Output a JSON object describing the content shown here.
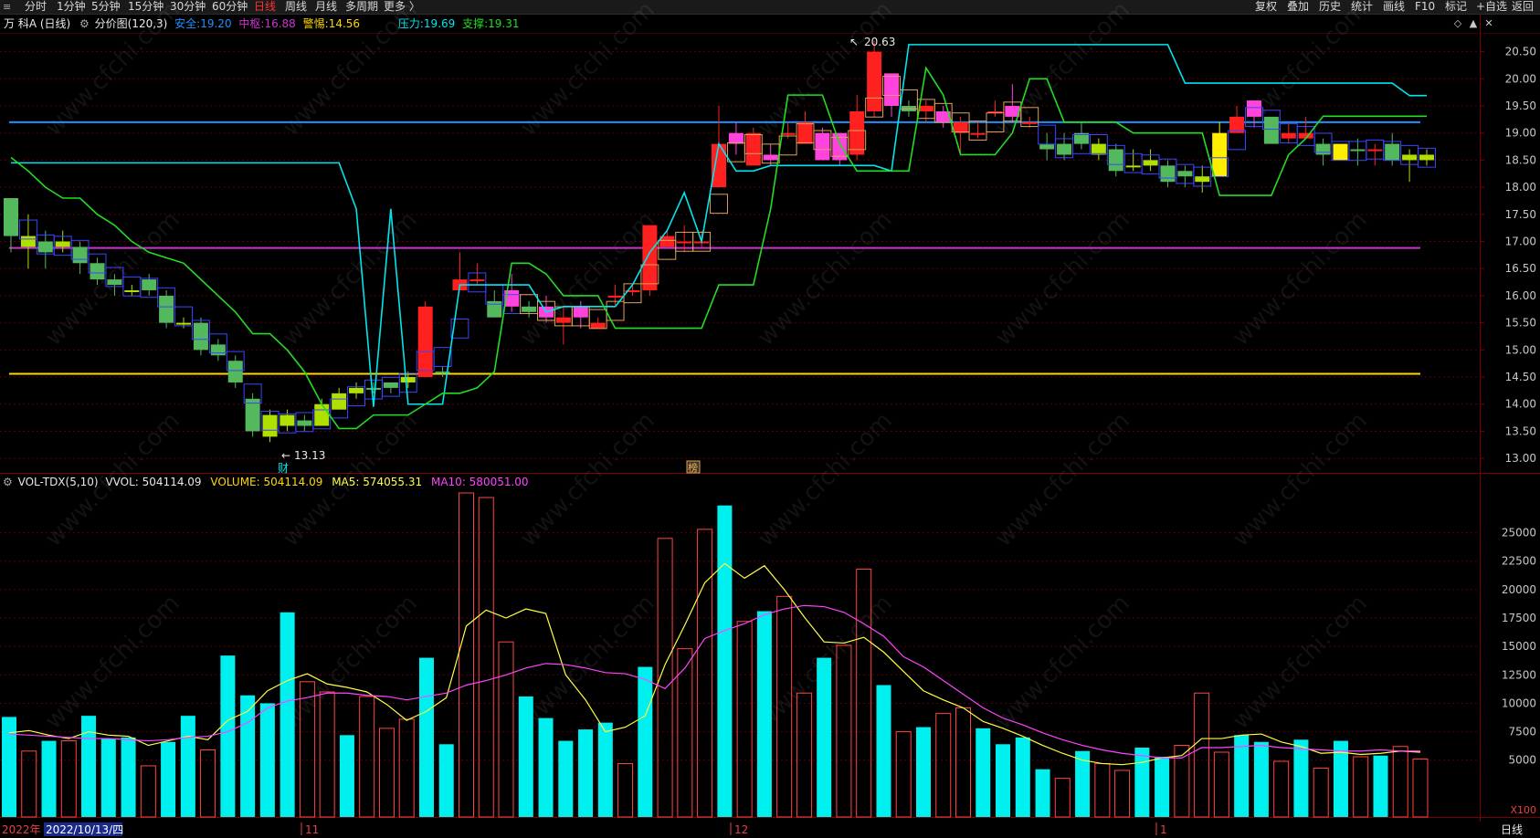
{
  "toolbar": {
    "periods": [
      "分时",
      "1分钟",
      "5分钟",
      "15分钟",
      "30分钟",
      "60分钟",
      "日线",
      "周线",
      "月线",
      "多周期",
      "更多 〉"
    ],
    "active_period": "日线",
    "right_buttons": [
      "复权",
      "叠加",
      "历史",
      "统计",
      "画线",
      "F10",
      "标记",
      "+自选",
      "返回"
    ]
  },
  "info": {
    "stock": "万 科A (日线)",
    "indicator": "分价图(120,3)",
    "safe_label": "安全:",
    "safe_value": "19.20",
    "mid_label": "中枢:",
    "mid_value": "16.88",
    "warn_label": "警惕:",
    "warn_value": "14.56",
    "pressure_label": "压力:",
    "pressure_value": "19.69",
    "support_label": "支撑:",
    "support_value": "19.31",
    "high_marker": "20.63",
    "low_marker": "13.13",
    "cai_marker": "财",
    "bang_marker": "榜"
  },
  "volume_info": {
    "name": "VOL-TDX(5,10)",
    "vvol": "VVOL: 504114.09",
    "volume": "VOLUME: 504114.09",
    "ma5": "MA5: 574055.31",
    "ma10": "MA10: 580051.00",
    "unit": "X100"
  },
  "dates": {
    "year_prefix": "2022年",
    "cursor_date": "2022/10/13/四",
    "nov": "11",
    "dec": "12",
    "jan": "1",
    "period_tab": "日线"
  },
  "watermark": "www.cfchi.com",
  "colors": {
    "up": "#ff2020",
    "up_pink": "#ff44dd",
    "down": "#54b85c",
    "down_lime": "#b0e000",
    "down_yellow": "#ffee00",
    "safe": "#1e90ff",
    "mid": "#cc33cc",
    "warn": "#ffd700",
    "pressure": "#00e5ee",
    "support": "#22dd22",
    "vol_up": "#ff4444",
    "vol_down": "#00f0f0"
  },
  "chart_data": {
    "type": "candlestick",
    "price_axis": {
      "ticks": [
        13.0,
        13.5,
        14.0,
        14.5,
        15.0,
        15.5,
        16.0,
        16.5,
        17.0,
        17.5,
        18.0,
        18.5,
        19.0,
        19.5,
        20.0,
        20.5
      ],
      "labels": [
        "13.00",
        "13.50",
        "14.00",
        "14.50",
        "15.00",
        "15.50",
        "16.00",
        "16.50",
        "17.00",
        "17.50",
        "18.00",
        "18.50",
        "19.00",
        "19.50",
        "20.00",
        "20.50"
      ],
      "range": [
        12.75,
        20.83
      ]
    },
    "volume_axis": {
      "ticks": [
        5000,
        7500,
        10000,
        12500,
        15000,
        17500,
        20000,
        22500,
        25000
      ],
      "labels": [
        "5000",
        "7500",
        "10000",
        "12500",
        "15000",
        "17500",
        "20000",
        "22500",
        "25000"
      ],
      "range": [
        0,
        28500
      ]
    },
    "levels": {
      "safe": 19.2,
      "mid": 16.88,
      "warn": 14.56
    },
    "candles": [
      [
        17.8,
        17.1,
        17.8,
        16.8,
        "d"
      ],
      [
        17.1,
        16.9,
        17.5,
        16.5,
        "l"
      ],
      [
        17.0,
        16.8,
        17.2,
        16.5,
        "d"
      ],
      [
        16.9,
        17.0,
        17.2,
        16.8,
        "l"
      ],
      [
        16.9,
        16.6,
        17.0,
        16.4,
        "d"
      ],
      [
        16.6,
        16.3,
        16.7,
        16.2,
        "d"
      ],
      [
        16.3,
        16.2,
        16.4,
        16.0,
        "d"
      ],
      [
        16.1,
        16.1,
        16.2,
        16.0,
        "l"
      ],
      [
        16.3,
        16.1,
        16.4,
        16.0,
        "d"
      ],
      [
        16.0,
        15.5,
        16.1,
        15.4,
        "d"
      ],
      [
        15.5,
        15.5,
        15.6,
        15.4,
        "l"
      ],
      [
        15.5,
        15.0,
        15.6,
        14.9,
        "d"
      ],
      [
        15.1,
        14.9,
        15.2,
        14.8,
        "d"
      ],
      [
        14.8,
        14.4,
        14.9,
        14.3,
        "d"
      ],
      [
        14.1,
        13.5,
        14.2,
        13.4,
        "d"
      ],
      [
        13.8,
        13.4,
        13.9,
        13.3,
        "l"
      ],
      [
        13.8,
        13.6,
        13.9,
        13.5,
        "l"
      ],
      [
        13.7,
        13.6,
        13.8,
        13.5,
        "d"
      ],
      [
        14.0,
        13.6,
        14.1,
        13.6,
        "l"
      ],
      [
        14.2,
        13.9,
        14.3,
        13.9,
        "l"
      ],
      [
        14.2,
        14.3,
        14.4,
        14.1,
        "l"
      ],
      [
        14.3,
        14.3,
        14.4,
        14.2,
        "d"
      ],
      [
        14.3,
        14.4,
        14.4,
        14.2,
        "d"
      ],
      [
        14.4,
        14.5,
        14.6,
        14.3,
        "l"
      ],
      [
        14.5,
        15.8,
        15.9,
        14.5,
        "u"
      ],
      [
        14.6,
        14.6,
        14.7,
        14.5,
        "d"
      ],
      [
        16.1,
        16.3,
        16.8,
        16.1,
        "u"
      ],
      [
        16.3,
        16.3,
        16.6,
        16.2,
        "u"
      ],
      [
        15.9,
        15.6,
        16.1,
        15.6,
        "d"
      ],
      [
        15.8,
        16.1,
        16.4,
        15.7,
        "p"
      ],
      [
        15.8,
        15.7,
        15.9,
        15.6,
        "d"
      ],
      [
        15.6,
        15.8,
        16.0,
        15.5,
        "p"
      ],
      [
        15.5,
        15.6,
        15.8,
        15.1,
        "u"
      ],
      [
        15.6,
        15.8,
        15.9,
        15.4,
        "p"
      ],
      [
        15.4,
        15.5,
        15.6,
        15.4,
        "u"
      ],
      [
        16.0,
        16.0,
        16.2,
        15.8,
        "u"
      ],
      [
        16.1,
        16.1,
        16.2,
        16.0,
        "u"
      ],
      [
        16.1,
        17.3,
        17.3,
        16.0,
        "u"
      ],
      [
        16.9,
        17.1,
        17.2,
        16.9,
        "u"
      ],
      [
        17.0,
        17.0,
        17.3,
        16.8,
        "u"
      ],
      [
        17.0,
        17.0,
        17.2,
        16.9,
        "u"
      ],
      [
        18.0,
        18.8,
        19.5,
        18.0,
        "u"
      ],
      [
        18.8,
        19.0,
        19.2,
        18.6,
        "p"
      ],
      [
        18.4,
        19.0,
        19.1,
        18.4,
        "u"
      ],
      [
        18.6,
        18.5,
        18.8,
        18.4,
        "p"
      ],
      [
        19.0,
        19.0,
        19.2,
        18.9,
        "u"
      ],
      [
        18.8,
        19.2,
        19.4,
        18.8,
        "u"
      ],
      [
        18.5,
        19.0,
        19.1,
        18.5,
        "p"
      ],
      [
        18.5,
        19.0,
        19.0,
        18.4,
        "p"
      ],
      [
        18.6,
        19.4,
        19.7,
        18.5,
        "u"
      ],
      [
        19.4,
        20.5,
        20.7,
        19.3,
        "u"
      ],
      [
        19.5,
        20.1,
        20.1,
        19.3,
        "p"
      ],
      [
        19.5,
        19.4,
        19.6,
        19.3,
        "d"
      ],
      [
        19.4,
        19.5,
        19.6,
        19.2,
        "u"
      ],
      [
        19.2,
        19.4,
        19.5,
        19.1,
        "p"
      ],
      [
        19.2,
        19.0,
        19.3,
        18.6,
        "u"
      ],
      [
        19.0,
        19.0,
        19.2,
        18.9,
        "u"
      ],
      [
        19.4,
        19.4,
        19.6,
        19.3,
        "u"
      ],
      [
        19.3,
        19.5,
        19.9,
        19.2,
        "p"
      ],
      [
        19.2,
        19.2,
        19.3,
        19.1,
        "u"
      ],
      [
        18.8,
        18.7,
        19.0,
        18.5,
        "d"
      ],
      [
        18.8,
        18.6,
        19.0,
        18.5,
        "d"
      ],
      [
        19.0,
        18.8,
        19.2,
        18.7,
        "d"
      ],
      [
        18.8,
        18.6,
        18.9,
        18.5,
        "l"
      ],
      [
        18.7,
        18.3,
        18.8,
        18.2,
        "d"
      ],
      [
        18.4,
        18.4,
        18.7,
        18.3,
        "l"
      ],
      [
        18.5,
        18.4,
        18.7,
        18.3,
        "l"
      ],
      [
        18.4,
        18.1,
        18.5,
        18.0,
        "d"
      ],
      [
        18.3,
        18.2,
        18.4,
        18.0,
        "d"
      ],
      [
        18.2,
        18.1,
        18.4,
        17.9,
        "l"
      ],
      [
        18.2,
        19.0,
        19.2,
        18.2,
        "y"
      ],
      [
        19.0,
        19.3,
        19.5,
        19.0,
        "u"
      ],
      [
        19.3,
        19.6,
        19.6,
        19.1,
        "p"
      ],
      [
        19.3,
        18.8,
        19.3,
        18.8,
        "d"
      ],
      [
        18.9,
        19.0,
        19.2,
        18.8,
        "u"
      ],
      [
        18.9,
        19.0,
        19.3,
        18.9,
        "u"
      ],
      [
        18.8,
        18.6,
        18.9,
        18.4,
        "d"
      ],
      [
        18.8,
        18.5,
        18.8,
        18.5,
        "y"
      ],
      [
        18.7,
        18.7,
        18.9,
        18.4,
        "d"
      ],
      [
        18.7,
        18.7,
        18.8,
        18.4,
        "u"
      ],
      [
        18.8,
        18.5,
        19.0,
        18.4,
        "d"
      ],
      [
        18.6,
        18.5,
        18.7,
        18.1,
        "l"
      ],
      [
        18.6,
        18.5,
        18.7,
        18.4,
        "l"
      ]
    ],
    "volumes": [
      [
        8800,
        "d"
      ],
      [
        5800,
        "u"
      ],
      [
        6700,
        "d"
      ],
      [
        6700,
        "u"
      ],
      [
        8900,
        "d"
      ],
      [
        6900,
        "d"
      ],
      [
        7000,
        "d"
      ],
      [
        4500,
        "u"
      ],
      [
        6600,
        "d"
      ],
      [
        8900,
        "d"
      ],
      [
        5900,
        "u"
      ],
      [
        14200,
        "d"
      ],
      [
        10700,
        "d"
      ],
      [
        10000,
        "d"
      ],
      [
        18000,
        "d"
      ],
      [
        11900,
        "u"
      ],
      [
        11000,
        "u"
      ],
      [
        7200,
        "d"
      ],
      [
        10600,
        "u"
      ],
      [
        7800,
        "u"
      ],
      [
        8600,
        "u"
      ],
      [
        14000,
        "d"
      ],
      [
        6400,
        "d"
      ],
      [
        28500,
        "u"
      ],
      [
        28100,
        "u"
      ],
      [
        15400,
        "u"
      ],
      [
        10600,
        "d"
      ],
      [
        8700,
        "d"
      ],
      [
        6700,
        "d"
      ],
      [
        7700,
        "d"
      ],
      [
        8300,
        "d"
      ],
      [
        4700,
        "u"
      ],
      [
        13200,
        "d"
      ],
      [
        24500,
        "u"
      ],
      [
        14800,
        "u"
      ],
      [
        25300,
        "u"
      ],
      [
        27400,
        "d"
      ],
      [
        17200,
        "u"
      ],
      [
        18100,
        "d"
      ],
      [
        19400,
        "u"
      ],
      [
        10900,
        "u"
      ],
      [
        14000,
        "d"
      ],
      [
        15100,
        "u"
      ],
      [
        21800,
        "u"
      ],
      [
        11600,
        "d"
      ],
      [
        7500,
        "u"
      ],
      [
        7900,
        "d"
      ],
      [
        9100,
        "u"
      ],
      [
        9600,
        "u"
      ],
      [
        7800,
        "d"
      ],
      [
        6400,
        "d"
      ],
      [
        7000,
        "d"
      ],
      [
        4200,
        "d"
      ],
      [
        3400,
        "u"
      ],
      [
        5800,
        "d"
      ],
      [
        4700,
        "u"
      ],
      [
        4100,
        "u"
      ],
      [
        6100,
        "d"
      ],
      [
        5300,
        "d"
      ],
      [
        6300,
        "u"
      ],
      [
        10900,
        "u"
      ],
      [
        5700,
        "u"
      ],
      [
        7200,
        "d"
      ],
      [
        6600,
        "d"
      ],
      [
        4900,
        "u"
      ],
      [
        6800,
        "d"
      ],
      [
        4300,
        "u"
      ],
      [
        6700,
        "d"
      ],
      [
        5300,
        "u"
      ],
      [
        5400,
        "d"
      ],
      [
        6200,
        "u"
      ],
      [
        5100,
        "u"
      ]
    ],
    "vol_ma5": [
      7400,
      7600,
      7200,
      6900,
      7500,
      7200,
      7100,
      6300,
      6700,
      7100,
      6800,
      8500,
      9300,
      11100,
      12000,
      12600,
      11700,
      11400,
      11000,
      9900,
      8500,
      9300,
      10500,
      16800,
      18200,
      17500,
      18300,
      17900,
      12500,
      10300,
      7500,
      7900,
      8900,
      13400,
      16900,
      20600,
      22300,
      21000,
      22100,
      20000,
      17600,
      15400,
      15300,
      15800,
      14500,
      12800,
      11100,
      10300,
      9600,
      8400,
      7800,
      7100,
      6300,
      5600,
      5000,
      4700,
      4600,
      4800,
      5200,
      5400,
      6900,
      6900,
      7200,
      7300,
      6600,
      6200,
      5600,
      5700,
      5500,
      5600,
      5800,
      5700
    ],
    "vol_ma10": [
      7300,
      7200,
      7100,
      7000,
      6900,
      6900,
      6800,
      6700,
      6800,
      7000,
      7100,
      7500,
      8300,
      9600,
      10200,
      10500,
      10900,
      10900,
      10700,
      10600,
      10300,
      10600,
      10900,
      11600,
      12000,
      12500,
      13100,
      13500,
      13400,
      13100,
      12700,
      12600,
      12100,
      11300,
      13100,
      15700,
      16400,
      17000,
      17800,
      18300,
      18600,
      18500,
      18000,
      17000,
      15900,
      14100,
      13200,
      12000,
      10800,
      9600,
      8700,
      8100,
      7400,
      6800,
      6300,
      5900,
      5600,
      5400,
      5200,
      5200,
      6100,
      6100,
      6200,
      6300,
      6100,
      6000,
      5900,
      5800,
      5800,
      5900,
      5800,
      5800
    ]
  }
}
